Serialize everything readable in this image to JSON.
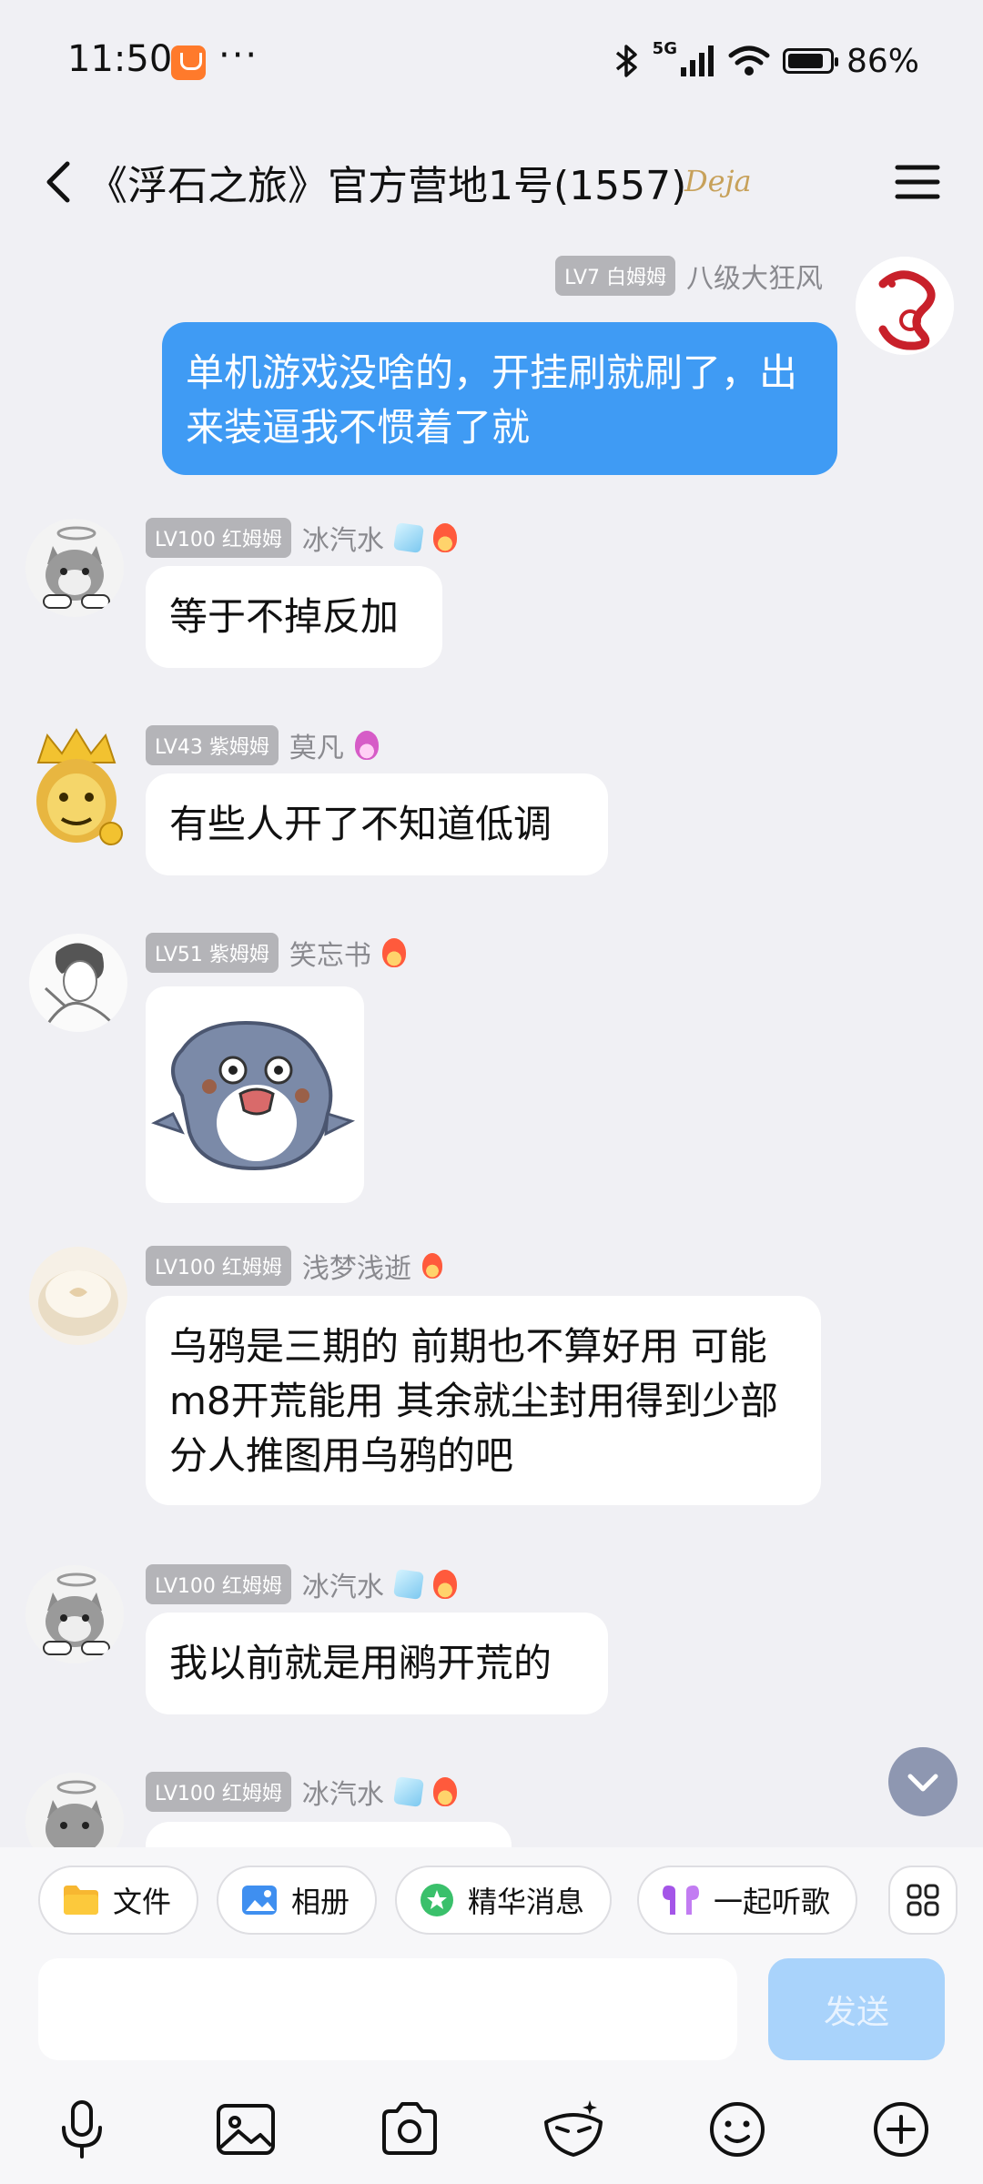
{
  "status_bar": {
    "time": "11:50",
    "dots": "···",
    "network": "5G",
    "battery_percent": "86%",
    "battery_level": 0.86
  },
  "header": {
    "title": "《浮石之旅》官方营地1号(1557)",
    "decoration_text": "Deja"
  },
  "messages": [
    {
      "badge": "LV7 白姆姆",
      "name": "八级大狂风",
      "text": "单机游戏没啥的，开挂刷就刷了，出来装逼我不惯着了就",
      "mine": true
    },
    {
      "badge": "LV100 红姆姆",
      "name": "冰汽水",
      "text": "等于不掉反加"
    },
    {
      "badge": "LV43 紫姆姆",
      "name": "莫凡",
      "text": "有些人开了不知道低调"
    },
    {
      "badge": "LV51 紫姆姆",
      "name": "笑忘书",
      "text": ""
    },
    {
      "badge": "LV100 红姆姆",
      "name": "浅梦浅逝",
      "text": "乌鸦是三期的 前期也不算好用 可能m8开荒能用 其余就尘封用得到少部分人推图用乌鸦的吧"
    },
    {
      "badge": "LV100 红姆姆",
      "name": "冰汽水",
      "text": "我以前就是用鹇开荒的"
    },
    {
      "badge": "LV100 红姆姆",
      "name": "冰汽水",
      "text": ""
    }
  ],
  "quick_actions": [
    {
      "label": "文件",
      "icon": "folder-icon"
    },
    {
      "label": "相册",
      "icon": "photo-icon"
    },
    {
      "label": "精华消息",
      "icon": "star-badge-icon"
    },
    {
      "label": "一起听歌",
      "icon": "earbuds-icon"
    }
  ],
  "composer": {
    "placeholder": "",
    "send_label": "发送"
  },
  "toolbar": [
    "microphone-icon",
    "image-icon",
    "camera-icon",
    "mask-icon",
    "emoji-icon",
    "plus-icon"
  ],
  "colors": {
    "background": "#f0f0f4",
    "my_bubble": "#3f9bf4",
    "send_disabled": "#a9d3fb",
    "badge": "#b4b4b8"
  }
}
